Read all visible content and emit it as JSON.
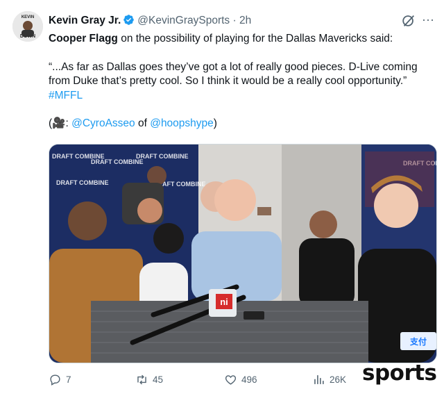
{
  "author": {
    "name": "Kevin Gray Jr.",
    "handle": "@KevinGraySports",
    "separator": "·",
    "time": "2h",
    "avatar_text_top": "KEVIN",
    "avatar_text_bottom": "DOWN"
  },
  "tweet": {
    "line1_bold": "Cooper Flagg",
    "line1_rest": " on the possibility of playing for the Dallas Mavericks said:",
    "quote": "“...As far as Dallas goes they’ve got a lot of really good pieces. D-Live coming from Duke that’s pretty cool. So I think it would be a really cool opportunity.” ",
    "hashtag": "#MFFL",
    "credit_open": "(",
    "credit_camera": "🎥",
    "credit_colon": ": ",
    "credit_user1": "@CyroAsseo",
    "credit_of": " of ",
    "credit_user2": "@hoopshype",
    "credit_close": ")"
  },
  "media": {
    "backdrop_text": "DRAFT COMBINE",
    "mic_logo": "ni",
    "badge_text": "支付"
  },
  "actions": {
    "replies": "7",
    "reposts": "45",
    "likes": "496",
    "views": "26K"
  },
  "watermark": "sports",
  "colors": {
    "link": "#1d9bf0",
    "muted": "#536471",
    "verified": "#1d9bf0",
    "backdrop": "#1c2d63"
  }
}
